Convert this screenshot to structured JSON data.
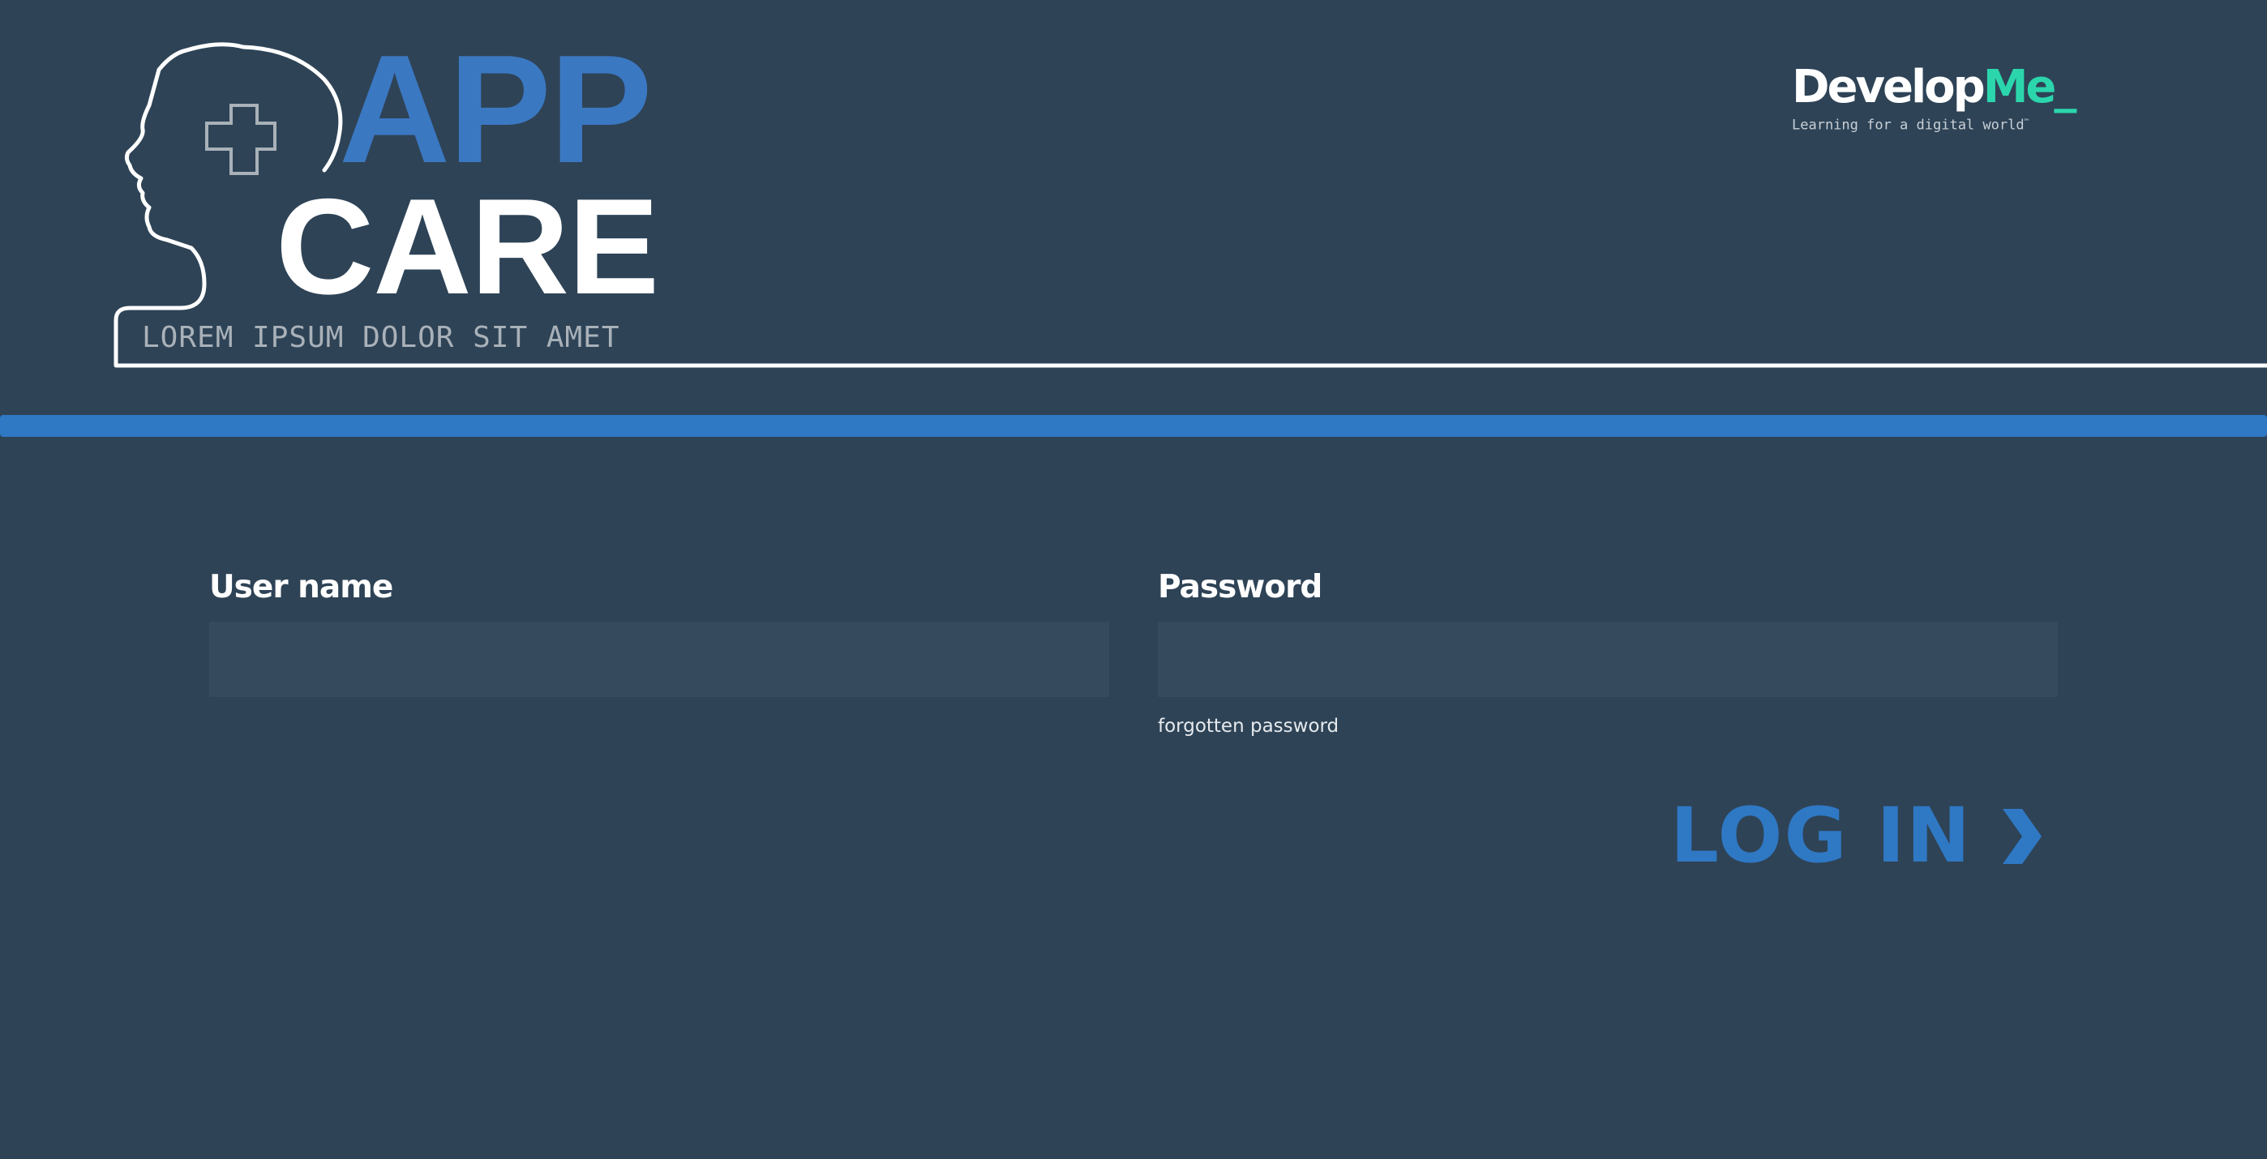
{
  "logo": {
    "app": "APP",
    "care": "CARE",
    "tagline": "LOREM IPSUM DOLOR SIT AMET"
  },
  "brand": {
    "name_main": "Develop",
    "name_accent": "Me_",
    "subtitle": "Learning for a digital world",
    "trademark": "™"
  },
  "form": {
    "username": {
      "label": "User name",
      "value": "",
      "placeholder": ""
    },
    "password": {
      "label": "Password",
      "value": "",
      "placeholder": ""
    },
    "forgot_link": "forgotten password",
    "login_label": "LOG IN"
  },
  "colors": {
    "background": "#2e4356",
    "accent_blue": "#2f78c4",
    "logo_blue": "#3b78c2",
    "brand_accent": "#2bd6ad",
    "input_bg": "#354a5c"
  },
  "icons": [
    "head-outline-icon",
    "medical-cross-icon",
    "chevron-right-icon"
  ]
}
